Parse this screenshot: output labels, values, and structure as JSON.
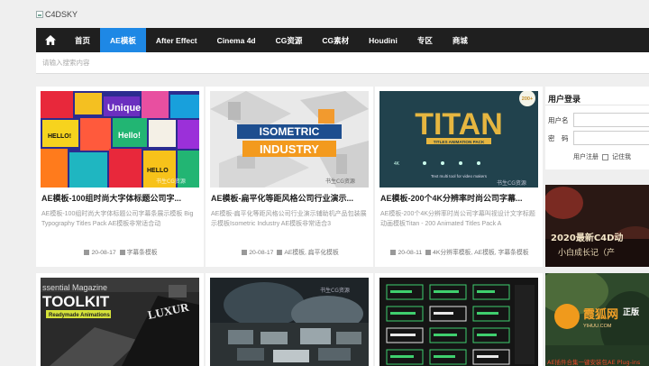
{
  "logo": {
    "alt": "C4DSKY"
  },
  "nav": {
    "items": [
      "首页",
      "AE模板",
      "After Effect",
      "Cinema 4d",
      "CG资源",
      "CG素材",
      "Houdini",
      "专区",
      "商城"
    ]
  },
  "search": {
    "placeholder": "请输入搜索内容"
  },
  "cards": [
    {
      "title": "AE模板-100组时尚大字体标题公司字...",
      "desc": "AE模板-100组时尚大字体标题公司字幕条展示模板 Big Typography Titles Pack AE模板非常适合动",
      "date": "20-08-17",
      "tags": "字幕条模板",
      "thumb_text": [
        "Unique",
        "HELLO!",
        "Hello!",
        "HELLO"
      ]
    },
    {
      "title": "AE模板-扁平化等距风格公司行业演示...",
      "desc": "AE模板-扁平化等距风格公司行业演示辅助机产品包装展示模板Isometric Industry AE模板非常适合3",
      "date": "20-08-17",
      "tags": "AE模板, 扁平化模板",
      "thumb_text": [
        "ISOMETRIC",
        "INDUSTRY"
      ]
    },
    {
      "title": "AE模板-200个4K分辨率时尚公司字幕...",
      "desc": "AE模板-200个4K分辨率时尚公司字幕叫视设计文字标题动画模板Titan - 200 Animated Titles Pack A",
      "date": "20-08-11",
      "tags": "4K分辨率模板, AE模板, 字幕条模板",
      "thumb_text": [
        "TITAN",
        "TITLES ANIMATION PACK",
        "200+",
        "4K",
        "Text multi tool for video makers"
      ]
    },
    {
      "thumb_text": [
        "ssential Magazine",
        "TOOLKIT",
        "Readymade Animations",
        "LUXUR"
      ]
    },
    {
      "thumb_text": []
    },
    {
      "thumb_text": []
    }
  ],
  "login": {
    "title": "用户登录",
    "username_label": "用户名",
    "password_label": "密　码",
    "register": "用户注册",
    "remember": "记住我"
  },
  "side": {
    "banner1_text": [
      "2020最新C4D动",
      "小白成长记（产"
    ],
    "banner2_text": [
      "霞狐网",
      "YIHUU.COM",
      "正版"
    ],
    "banner2_caption": "AE插件合集一键安装包AE Plug-ins"
  },
  "watermark": "书生CG资源",
  "colors": {
    "nav_bg": "#1f1f1f",
    "nav_active": "#1e88e5",
    "page_bg": "#efefef"
  }
}
